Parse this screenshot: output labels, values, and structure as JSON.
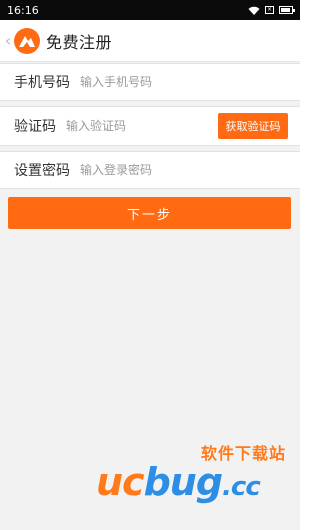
{
  "status_bar": {
    "time": "16:16",
    "icons": [
      "wifi-icon",
      "sim-icon",
      "battery-icon"
    ]
  },
  "header": {
    "title": "免费注册",
    "back_icon": "chevron-left-icon",
    "logo_icon": "app-logo-icon"
  },
  "form": {
    "phone": {
      "label": "手机号码",
      "placeholder": "输入手机号码",
      "value": ""
    },
    "code": {
      "label": "验证码",
      "placeholder": "输入验证码",
      "value": "",
      "button_label": "获取验证码"
    },
    "password": {
      "label": "设置密码",
      "placeholder": "输入登录密码",
      "value": ""
    }
  },
  "next_button_label": "下一步",
  "watermark": {
    "site_name": "软件下载站",
    "brand_orange": "uc",
    "brand_blue": "bug",
    "brand_tld": ".cc"
  },
  "colors": {
    "accent": "#ff6a13",
    "background": "#f2f2f2",
    "watermark_blue": "#2d8ee6"
  }
}
